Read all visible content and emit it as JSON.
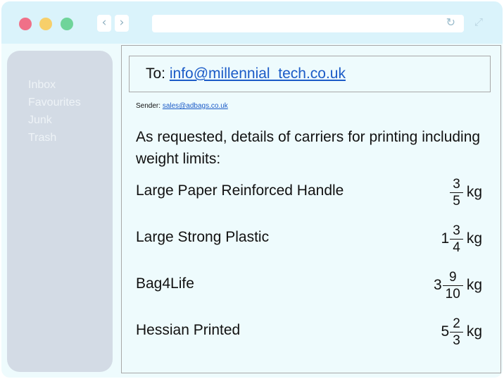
{
  "window": {
    "traffic_lights": [
      "#f07088",
      "#f7cf6a",
      "#6fd49a"
    ],
    "icons": {
      "back": "chevron-left",
      "forward": "chevron-right",
      "reload": "reload",
      "expand": "expand"
    },
    "url": ""
  },
  "sidebar": {
    "items": [
      {
        "label": "Inbox"
      },
      {
        "label": "Favourites"
      },
      {
        "label": "Junk"
      },
      {
        "label": "Trash"
      }
    ]
  },
  "email": {
    "to_label": "To: ",
    "to_address": "info@millennial_tech.co.uk",
    "sender_label": "Sender: ",
    "sender_address": "sales@adbags.co.uk",
    "intro": "As requested, details of carriers for printing including weight limits:",
    "items": [
      {
        "name": "Large Paper Reinforced Handle",
        "whole": "",
        "numerator": "3",
        "denominator": "5",
        "unit": "kg"
      },
      {
        "name": "Large Strong Plastic",
        "whole": "1",
        "numerator": "3",
        "denominator": "4",
        "unit": "kg"
      },
      {
        "name": "Bag4Life",
        "whole": "3",
        "numerator": "9",
        "denominator": "10",
        "unit": "kg"
      },
      {
        "name": "Hessian Printed",
        "whole": "5",
        "numerator": "2",
        "denominator": "3",
        "unit": "kg"
      }
    ]
  }
}
